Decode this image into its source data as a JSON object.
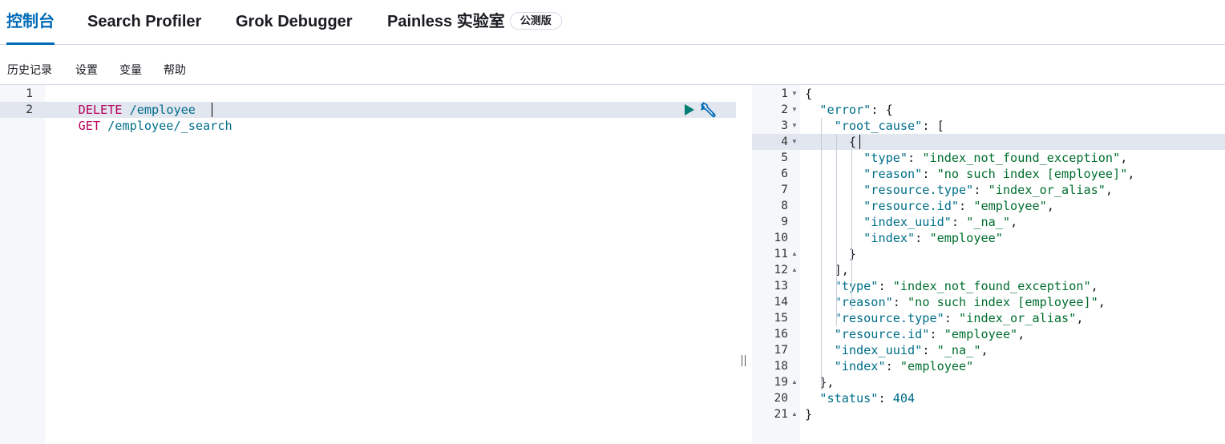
{
  "tabs": [
    {
      "label": "控制台",
      "active": true
    },
    {
      "label": "Search Profiler",
      "active": false
    },
    {
      "label": "Grok Debugger",
      "active": false
    },
    {
      "label": "Painless 实验室",
      "active": false,
      "badge": "公测版"
    }
  ],
  "menu": [
    "历史记录",
    "设置",
    "变量",
    "帮助"
  ],
  "request_editor": {
    "lines": [
      {
        "num": "1",
        "method": "DELETE",
        "path": " /employee"
      },
      {
        "num": "2",
        "method": "GET",
        "path": " /employee/_search"
      }
    ],
    "icons": {
      "run": "play-icon",
      "settings": "wrench-icon"
    }
  },
  "response_editor": {
    "line_numbers": [
      "1",
      "2",
      "3",
      "4",
      "5",
      "6",
      "7",
      "8",
      "9",
      "10",
      "11",
      "12",
      "13",
      "14",
      "15",
      "16",
      "17",
      "18",
      "19",
      "20",
      "21"
    ],
    "lines": [
      "{",
      "  \"error\": {",
      "    \"root_cause\": [",
      "      {",
      "        \"type\": \"index_not_found_exception\",",
      "        \"reason\": \"no such index [employee]\",",
      "        \"resource.type\": \"index_or_alias\",",
      "        \"resource.id\": \"employee\",",
      "        \"index_uuid\": \"_na_\",",
      "        \"index\": \"employee\"",
      "      }",
      "    ],",
      "    \"type\": \"index_not_found_exception\",",
      "    \"reason\": \"no such index [employee]\",",
      "    \"resource.type\": \"index_or_alias\",",
      "    \"resource.id\": \"employee\",",
      "    \"index_uuid\": \"_na_\",",
      "    \"index\": \"employee\"",
      "  },",
      "  \"status\": 404",
      "}"
    ]
  },
  "colors": {
    "accent": "#006bb8",
    "method": "#b8005c",
    "key": "#006e8a",
    "string": "#006e2e"
  }
}
